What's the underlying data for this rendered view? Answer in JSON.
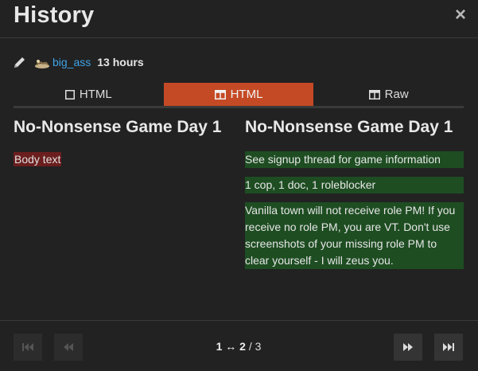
{
  "dialog": {
    "title": "History",
    "close_label": "×"
  },
  "meta": {
    "username": "big_ass",
    "age": "13 hours"
  },
  "tabs": [
    {
      "label": "HTML",
      "icon": "square-icon",
      "active": false
    },
    {
      "label": "HTML",
      "icon": "split-columns-icon",
      "active": true
    },
    {
      "label": "Raw",
      "icon": "split-columns-icon",
      "active": false
    }
  ],
  "left": {
    "title": "No-Nonsense Game Day 1",
    "deleted": "Body text"
  },
  "right": {
    "title": "No-Nonsense Game Day 1",
    "inserted": [
      "See signup thread for game information",
      "1 cop, 1 doc, 1 roleblocker",
      "Vanilla town will not receive role PM! If you receive no role PM, you are VT. Don't use screenshots of your missing role PM to clear yourself - I will zeus you."
    ]
  },
  "footer": {
    "current": "1",
    "arrow": "↔",
    "target": "2",
    "total": "3"
  },
  "colors": {
    "accent": "#c44a25",
    "deleted": "#6b1e1e",
    "inserted": "#1e4d22",
    "link": "#3ea3e6"
  }
}
